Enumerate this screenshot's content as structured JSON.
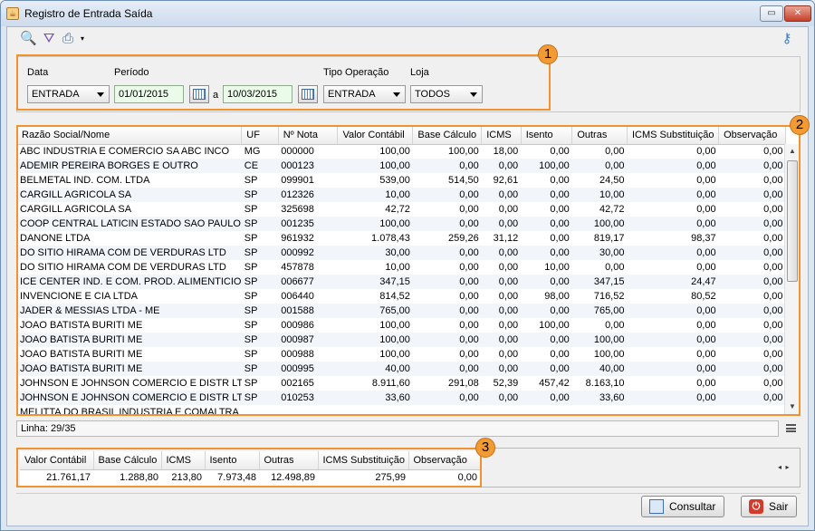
{
  "window": {
    "title": "Registro de Entrada Saída"
  },
  "icons": {
    "app": "java-cup-icon",
    "search": "search-icon",
    "filter": "filter-icon",
    "print": "printer-icon",
    "key": "key-icon",
    "calendar": "calendar-icon"
  },
  "colors": {
    "highlight": "#f0932e",
    "date_bg": "#eafbe9"
  },
  "filters": {
    "data_label": "Data",
    "data_value": "ENTRADA",
    "periodo_label": "Período",
    "periodo_from": "01/01/2015",
    "periodo_sep": "a",
    "periodo_to": "10/03/2015",
    "tipo_label": "Tipo Operação",
    "tipo_value": "ENTRADA",
    "loja_label": "Loja",
    "loja_value": "TODOS"
  },
  "badges": [
    "1",
    "2",
    "3"
  ],
  "grid": {
    "columns": [
      "Razão Social/Nome",
      "UF",
      "Nº Nota",
      "Valor Contábil",
      "Base Cálculo",
      "ICMS",
      "Isento",
      "Outras",
      "ICMS Substituição",
      "Observação"
    ],
    "rows": [
      [
        "ABC INDUSTRIA E COMERCIO SA ABC INCO",
        "MG",
        "000000",
        "100,00",
        "100,00",
        "18,00",
        "0,00",
        "0,00",
        "0,00",
        "0,00"
      ],
      [
        "ADEMIR PEREIRA BORGES E OUTRO",
        "CE",
        "000123",
        "100,00",
        "0,00",
        "0,00",
        "100,00",
        "0,00",
        "0,00",
        "0,00"
      ],
      [
        "BELMETAL IND. COM. LTDA",
        "SP",
        "099901",
        "539,00",
        "514,50",
        "92,61",
        "0,00",
        "24,50",
        "0,00",
        "0,00"
      ],
      [
        "CARGILL AGRICOLA SA",
        "SP",
        "012326",
        "10,00",
        "0,00",
        "0,00",
        "0,00",
        "10,00",
        "0,00",
        "0,00"
      ],
      [
        "CARGILL AGRICOLA SA",
        "SP",
        "325698",
        "42,72",
        "0,00",
        "0,00",
        "0,00",
        "42,72",
        "0,00",
        "0,00"
      ],
      [
        "COOP CENTRAL LATICIN ESTADO SAO PAULO",
        "SP",
        "001235",
        "100,00",
        "0,00",
        "0,00",
        "0,00",
        "100,00",
        "0,00",
        "0,00"
      ],
      [
        "DANONE LTDA",
        "SP",
        "961932",
        "1.078,43",
        "259,26",
        "31,12",
        "0,00",
        "819,17",
        "98,37",
        "0,00"
      ],
      [
        "DO SITIO HIRAMA COM DE VERDURAS LTD",
        "SP",
        "000992",
        "30,00",
        "0,00",
        "0,00",
        "0,00",
        "30,00",
        "0,00",
        "0,00"
      ],
      [
        "DO SITIO HIRAMA COM DE VERDURAS LTD",
        "SP",
        "457878",
        "10,00",
        "0,00",
        "0,00",
        "10,00",
        "0,00",
        "0,00",
        "0,00"
      ],
      [
        "ICE CENTER IND. E COM. PROD. ALIMENTICIO",
        "SP",
        "006677",
        "347,15",
        "0,00",
        "0,00",
        "0,00",
        "347,15",
        "24,47",
        "0,00"
      ],
      [
        "INVENCIONE E CIA LTDA",
        "SP",
        "006440",
        "814,52",
        "0,00",
        "0,00",
        "98,00",
        "716,52",
        "80,52",
        "0,00"
      ],
      [
        "JADER & MESSIAS LTDA - ME",
        "SP",
        "001588",
        "765,00",
        "0,00",
        "0,00",
        "0,00",
        "765,00",
        "0,00",
        "0,00"
      ],
      [
        "JOAO BATISTA BURITI ME",
        "SP",
        "000986",
        "100,00",
        "0,00",
        "0,00",
        "100,00",
        "0,00",
        "0,00",
        "0,00"
      ],
      [
        "JOAO BATISTA BURITI ME",
        "SP",
        "000987",
        "100,00",
        "0,00",
        "0,00",
        "0,00",
        "100,00",
        "0,00",
        "0,00"
      ],
      [
        "JOAO BATISTA BURITI ME",
        "SP",
        "000988",
        "100,00",
        "0,00",
        "0,00",
        "0,00",
        "100,00",
        "0,00",
        "0,00"
      ],
      [
        "JOAO BATISTA BURITI ME",
        "SP",
        "000995",
        "40,00",
        "0,00",
        "0,00",
        "0,00",
        "40,00",
        "0,00",
        "0,00"
      ],
      [
        "JOHNSON E JOHNSON COMERCIO E DISTR LTD",
        "SP",
        "002165",
        "8.911,60",
        "291,08",
        "52,39",
        "457,42",
        "8.163,10",
        "0,00",
        "0,00"
      ],
      [
        "JOHNSON E JOHNSON COMERCIO E DISTR LTD",
        "SP",
        "010253",
        "33,60",
        "0,00",
        "0,00",
        "0,00",
        "33,60",
        "0,00",
        "0,00"
      ]
    ],
    "partial_row_name": "MELITTA DO BRASIL INDUSTRIA E COMALTRA"
  },
  "status": {
    "linha": "Linha: 29/35"
  },
  "totals": {
    "columns": [
      "Valor Contábil",
      "Base Cálculo",
      "ICMS",
      "Isento",
      "Outras",
      "ICMS Substituição",
      "Observação"
    ],
    "values": [
      "21.761,17",
      "1.288,80",
      "213,80",
      "7.973,48",
      "12.498,89",
      "275,99",
      "0,00"
    ]
  },
  "buttons": {
    "consultar": "Consultar",
    "sair": "Sair"
  }
}
